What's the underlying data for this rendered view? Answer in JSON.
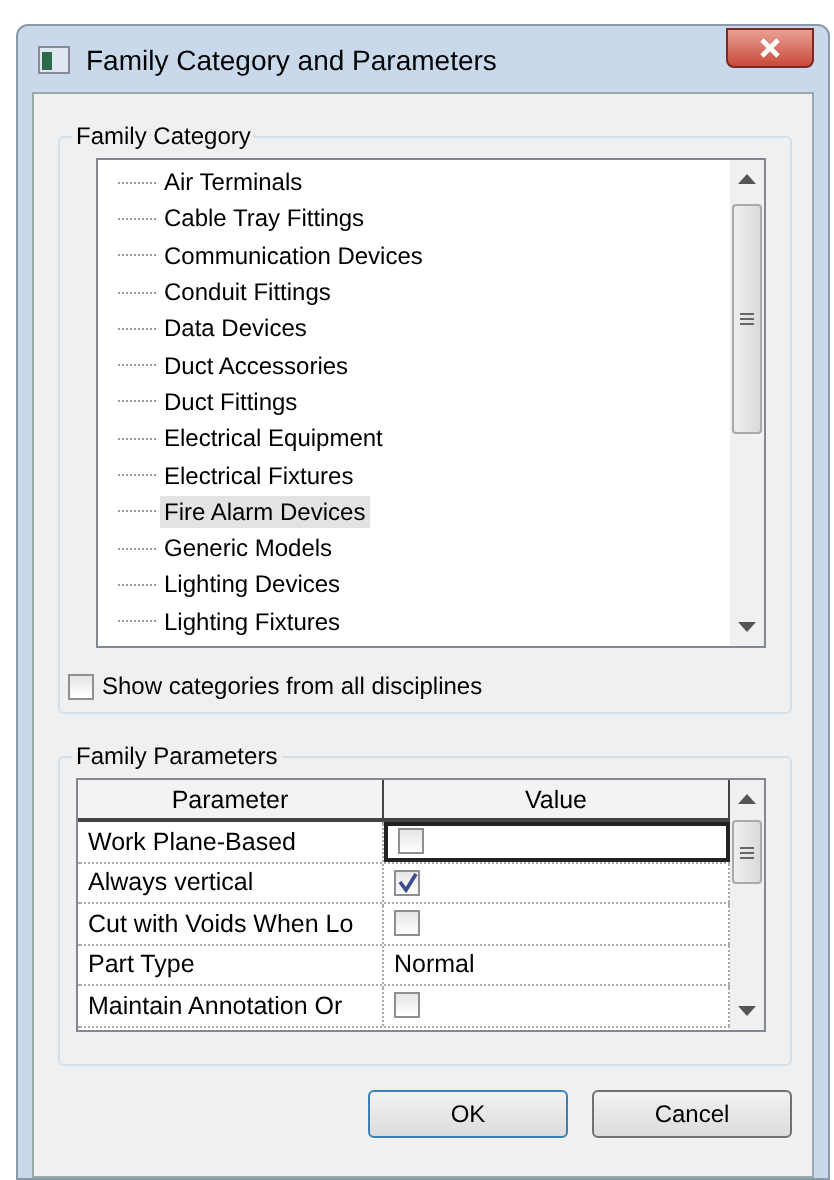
{
  "window": {
    "title": "Family Category and Parameters"
  },
  "family_category": {
    "title": "Family Category",
    "items": [
      {
        "label": "Air Terminals",
        "selected": false
      },
      {
        "label": "Cable Tray Fittings",
        "selected": false
      },
      {
        "label": "Communication Devices",
        "selected": false
      },
      {
        "label": "Conduit Fittings",
        "selected": false
      },
      {
        "label": "Data Devices",
        "selected": false
      },
      {
        "label": "Duct Accessories",
        "selected": false
      },
      {
        "label": "Duct Fittings",
        "selected": false
      },
      {
        "label": "Electrical Equipment",
        "selected": false
      },
      {
        "label": "Electrical Fixtures",
        "selected": false
      },
      {
        "label": "Fire Alarm Devices",
        "selected": true
      },
      {
        "label": "Generic Models",
        "selected": false
      },
      {
        "label": "Lighting Devices",
        "selected": false
      },
      {
        "label": "Lighting Fixtures",
        "selected": false
      }
    ],
    "show_all": {
      "label": "Show categories from all disciplines",
      "checked": false
    }
  },
  "family_parameters": {
    "title": "Family Parameters",
    "columns": [
      "Parameter",
      "Value"
    ],
    "rows": [
      {
        "parameter": "Work Plane-Based",
        "kind": "checkbox",
        "checked": false,
        "selected": true
      },
      {
        "parameter": "Always vertical",
        "kind": "checkbox",
        "checked": true,
        "selected": false
      },
      {
        "parameter": "Cut with Voids When Lo",
        "kind": "checkbox",
        "checked": false,
        "selected": false
      },
      {
        "parameter": "Part Type",
        "kind": "text",
        "value": "Normal",
        "selected": false
      },
      {
        "parameter": "Maintain Annotation Or",
        "kind": "checkbox",
        "checked": false,
        "selected": false
      }
    ]
  },
  "buttons": [
    "OK",
    "Cancel"
  ]
}
